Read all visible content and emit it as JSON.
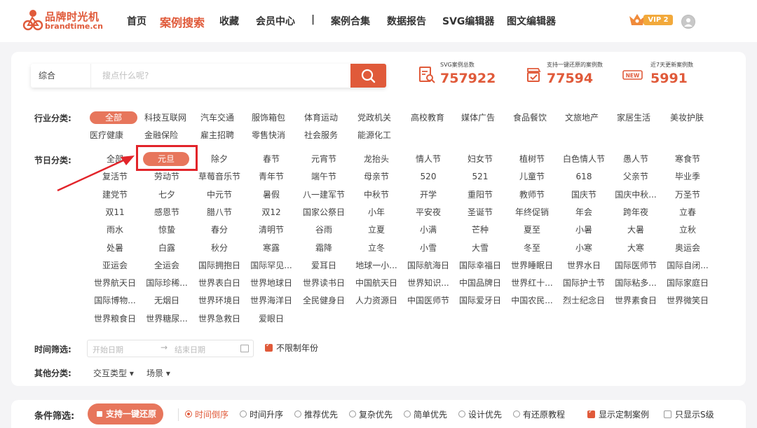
{
  "header": {
    "logo_cn": "品牌时光机",
    "logo_en": "brandtime.cn",
    "nav": [
      "首页",
      "案例搜索",
      "收藏",
      "会员中心",
      "|",
      "案例合集",
      "数据报告",
      "SVG编辑器",
      "图文编辑器"
    ],
    "active_nav": "案例搜索",
    "vip_label": "VIP 2"
  },
  "search": {
    "type": "综合",
    "placeholder": "搜点什么呢?"
  },
  "stats": [
    {
      "label": "SVG案例总数",
      "value": "757922"
    },
    {
      "label": "支持一键还原的案例数",
      "value": "77594"
    },
    {
      "label": "近7天更新案例数",
      "value": "5991",
      "badge": "NEW"
    }
  ],
  "industry": {
    "label": "行业分类:",
    "items": [
      "全部",
      "科技互联网",
      "汽车交通",
      "服饰箱包",
      "体育运动",
      "党政机关",
      "高校教育",
      "媒体广告",
      "食品餐饮",
      "文旅地产",
      "家居生活",
      "美妆护肤",
      "医疗健康",
      "金融保险",
      "雇主招聘",
      "零售快消",
      "社会服务",
      "能源化工"
    ],
    "selected": "全部"
  },
  "festival": {
    "label": "节日分类:",
    "selected": "元旦",
    "rows": [
      [
        "全部",
        "元旦",
        "除夕",
        "春节",
        "元宵节",
        "龙抬头",
        "情人节",
        "妇女节",
        "植树节",
        "白色情人节",
        "愚人节",
        "寒食节"
      ],
      [
        "复活节",
        "劳动节",
        "草莓音乐节",
        "青年节",
        "端午节",
        "母亲节",
        "520",
        "521",
        "儿童节",
        "618",
        "父亲节",
        "毕业季"
      ],
      [
        "建党节",
        "七夕",
        "中元节",
        "暑假",
        "八一建军节",
        "中秋节",
        "开学",
        "重阳节",
        "教师节",
        "国庆节",
        "国庆中秋...",
        "万圣节"
      ],
      [
        "双11",
        "感恩节",
        "腊八节",
        "双12",
        "国家公祭日",
        "小年",
        "平安夜",
        "圣诞节",
        "年终促销",
        "年会",
        "跨年夜",
        "立春"
      ],
      [
        "雨水",
        "惊蛰",
        "春分",
        "清明节",
        "谷雨",
        "立夏",
        "小满",
        "芒种",
        "夏至",
        "小暑",
        "大暑",
        "立秋"
      ],
      [
        "处暑",
        "白露",
        "秋分",
        "寒露",
        "霜降",
        "立冬",
        "小雪",
        "大雪",
        "冬至",
        "小寒",
        "大寒",
        "奥运会"
      ],
      [
        "亚运会",
        "全运会",
        "国际拥抱日",
        "国际罕见...",
        "爱耳日",
        "地球一小...",
        "国际航海日",
        "国际幸福日",
        "世界睡眠日",
        "世界水日",
        "国际医师节",
        "国际自闭..."
      ],
      [
        "世界航天日",
        "国际珍稀...",
        "世界表白日",
        "世界地球日",
        "世界读书日",
        "中国航天日",
        "世界知识...",
        "中国品牌日",
        "世界红十...",
        "国际护士节",
        "国际粘多...",
        "国际家庭日"
      ],
      [
        "国际博物...",
        "无烟日",
        "世界环境日",
        "世界海洋日",
        "全民健身日",
        "人力资源日",
        "中国医师节",
        "国际爱牙日",
        "中国农民...",
        "烈士纪念日",
        "世界素食日",
        "世界微笑日"
      ],
      [
        "世界粮食日",
        "世界糖尿...",
        "世界急救日",
        "爱眼日"
      ]
    ]
  },
  "time_filter": {
    "label": "时间筛选:",
    "start_placeholder": "开始日期",
    "arrow": "→",
    "end_placeholder": "结束日期",
    "unlimited_label": "不限制年份"
  },
  "other": {
    "label": "其他分类:",
    "interaction": "交互类型 ▾",
    "scene": "场景 ▾"
  },
  "filter_bar": {
    "label": "条件筛选:",
    "restore_button": "支持一键还原",
    "options": [
      "时间倒序",
      "时间升序",
      "推荐优先",
      "复杂优先",
      "简单优先",
      "设计优先",
      "有还原教程"
    ],
    "selected": "时间倒序",
    "checks": [
      {
        "label": "显示定制案例",
        "checked": true
      },
      {
        "label": "只显示S级",
        "checked": false
      }
    ]
  },
  "colors": {
    "accent": "#e05a3a",
    "tag_selected": "#e7765c",
    "annotation": "#e2242a"
  }
}
